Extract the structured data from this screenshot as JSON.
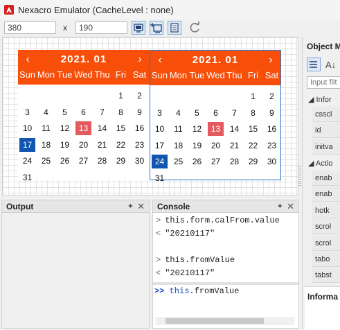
{
  "window": {
    "title": "Nexacro Emulator (CacheLevel : none)"
  },
  "toolbar": {
    "width_value": "380",
    "separator": "x",
    "height_value": "190"
  },
  "calendars": [
    {
      "title": "2021.  01",
      "weekdays": [
        "Sun",
        "Mon",
        "Tue",
        "Wed",
        "Thu",
        "Fri",
        "Sat"
      ],
      "weeks": [
        [
          "",
          "",
          "",
          "",
          "",
          "1",
          "2"
        ],
        [
          "3",
          "4",
          "5",
          "6",
          "7",
          "8",
          "9"
        ],
        [
          "10",
          "11",
          "12",
          "13",
          "14",
          "15",
          "16"
        ],
        [
          "17",
          "18",
          "19",
          "20",
          "21",
          "22",
          "23"
        ],
        [
          "24",
          "25",
          "26",
          "27",
          "28",
          "29",
          "30"
        ],
        [
          "31",
          "",
          "",
          "",
          "",
          "",
          ""
        ]
      ],
      "today": "13",
      "selected": "17"
    },
    {
      "title": "2021.  01",
      "weekdays": [
        "Sun",
        "Mon",
        "Tue",
        "Wed",
        "Thu",
        "Fri",
        "Sat"
      ],
      "weeks": [
        [
          "",
          "",
          "",
          "",
          "",
          "1",
          "2"
        ],
        [
          "3",
          "4",
          "5",
          "6",
          "7",
          "8",
          "9"
        ],
        [
          "10",
          "11",
          "12",
          "13",
          "14",
          "15",
          "16"
        ],
        [
          "17",
          "18",
          "19",
          "20",
          "21",
          "22",
          "23"
        ],
        [
          "24",
          "25",
          "26",
          "27",
          "28",
          "29",
          "30"
        ],
        [
          "31",
          "",
          "",
          "",
          "",
          "",
          ""
        ]
      ],
      "today": "13",
      "selected": "24"
    }
  ],
  "object_panel": {
    "title": "Object M",
    "filter_placeholder": "Input filt",
    "section_info": "Infor",
    "info_rows": [
      "csscl",
      "id",
      "initva"
    ],
    "section_action": "Actio",
    "action_rows": [
      "enab",
      "enab",
      "hotk",
      "scrol",
      "scrol",
      "tabo",
      "tabst"
    ],
    "footer": "Informa"
  },
  "output_panel": {
    "title": "Output"
  },
  "console_panel": {
    "title": "Console",
    "lines": [
      {
        "prefix": ">",
        "text": "this.form.calFrom.value"
      },
      {
        "prefix": "<",
        "text": "\"20210117\""
      },
      {
        "prefix": "",
        "text": ""
      },
      {
        "prefix": ">",
        "text": "this.fromValue"
      },
      {
        "prefix": "<",
        "text": "\"20210117\""
      }
    ],
    "prompt": ">>",
    "input_keyword": "this",
    "input_rest": ".fromValue"
  },
  "colors": {
    "calendar_header": "#f74f0a",
    "today_bg": "#e35a5f",
    "selected_bg": "#1055b0",
    "console_keyword": "#1a4fc4"
  },
  "icons": [
    "nexacro-logo-icon",
    "screen-fit-icon",
    "screen-add-icon",
    "document-icon",
    "refresh-icon",
    "pin-icon",
    "close-icon"
  ]
}
